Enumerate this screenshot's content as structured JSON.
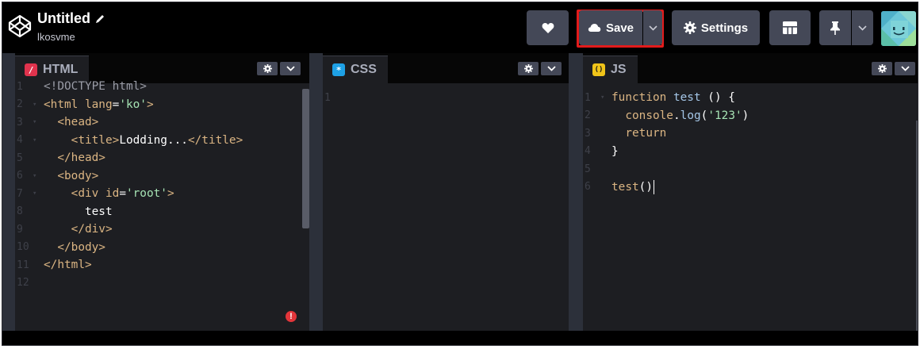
{
  "header": {
    "logo_icon": "codepen-logo-icon",
    "title": "Untitled",
    "author": "lkosvme",
    "save_label": "Save",
    "settings_label": "Settings"
  },
  "panes": {
    "html": {
      "label": "HTML",
      "icon_glyph": "/",
      "icon_color": "#e0334d",
      "lines": [
        {
          "n": "1",
          "fold": false,
          "tokens": [
            {
              "c": "doctype",
              "t": "<!DOCTYPE html>"
            }
          ]
        },
        {
          "n": "2",
          "fold": true,
          "tokens": [
            {
              "c": "tag",
              "t": "<html "
            },
            {
              "c": "attr",
              "t": "lang"
            },
            {
              "c": "txt",
              "t": "="
            },
            {
              "c": "str",
              "t": "'ko'"
            },
            {
              "c": "tag",
              "t": ">"
            }
          ]
        },
        {
          "n": "3",
          "fold": true,
          "tokens": [
            {
              "c": "tag",
              "t": "  <head>"
            }
          ]
        },
        {
          "n": "4",
          "fold": true,
          "tokens": [
            {
              "c": "tag",
              "t": "    <title>"
            },
            {
              "c": "txt",
              "t": "Lodding..."
            },
            {
              "c": "tag",
              "t": "</title>"
            }
          ]
        },
        {
          "n": "5",
          "fold": false,
          "tokens": [
            {
              "c": "tag",
              "t": "  </head>"
            }
          ]
        },
        {
          "n": "6",
          "fold": true,
          "tokens": [
            {
              "c": "tag",
              "t": "  <body>"
            }
          ]
        },
        {
          "n": "7",
          "fold": true,
          "tokens": [
            {
              "c": "tag",
              "t": "    <div "
            },
            {
              "c": "attr",
              "t": "id"
            },
            {
              "c": "txt",
              "t": "="
            },
            {
              "c": "str",
              "t": "'root'"
            },
            {
              "c": "tag",
              "t": ">"
            }
          ]
        },
        {
          "n": "8",
          "fold": false,
          "tokens": [
            {
              "c": "txt",
              "t": "      test"
            }
          ]
        },
        {
          "n": "9",
          "fold": false,
          "tokens": [
            {
              "c": "tag",
              "t": "    </div>"
            }
          ]
        },
        {
          "n": "10",
          "fold": false,
          "tokens": [
            {
              "c": "tag",
              "t": "  </body>"
            }
          ]
        },
        {
          "n": "11",
          "fold": false,
          "tokens": [
            {
              "c": "tag",
              "t": "</html>"
            }
          ]
        },
        {
          "n": "12",
          "fold": false,
          "tokens": []
        }
      ]
    },
    "css": {
      "label": "CSS",
      "icon_glyph": "*",
      "icon_color": "#1ea1e6",
      "lines": [
        {
          "n": "1",
          "fold": false,
          "tokens": []
        }
      ]
    },
    "js": {
      "label": "JS",
      "icon_glyph": "()",
      "icon_color": "#f0c419",
      "lines": [
        {
          "n": "1",
          "fold": true,
          "tokens": [
            {
              "c": "kw",
              "t": "function "
            },
            {
              "c": "fn",
              "t": "test"
            },
            {
              "c": "txt",
              "t": " () {"
            }
          ]
        },
        {
          "n": "2",
          "fold": false,
          "tokens": [
            {
              "c": "kw",
              "t": "  console"
            },
            {
              "c": "txt",
              "t": "."
            },
            {
              "c": "fn",
              "t": "log"
            },
            {
              "c": "txt",
              "t": "("
            },
            {
              "c": "str",
              "t": "'123'"
            },
            {
              "c": "txt",
              "t": ")"
            }
          ]
        },
        {
          "n": "3",
          "fold": false,
          "tokens": [
            {
              "c": "kw",
              "t": "  return"
            }
          ]
        },
        {
          "n": "4",
          "fold": false,
          "tokens": [
            {
              "c": "txt",
              "t": "}"
            }
          ]
        },
        {
          "n": "5",
          "fold": false,
          "tokens": []
        },
        {
          "n": "6",
          "fold": false,
          "tokens": [
            {
              "c": "kw",
              "t": "test"
            },
            {
              "c": "txt",
              "t": "()"
            }
          ],
          "cursor": true
        }
      ]
    }
  },
  "colors": {
    "accent_save_outline": "#e21b1b",
    "button_bg": "#444857",
    "editor_bg": "#1d1e22"
  }
}
